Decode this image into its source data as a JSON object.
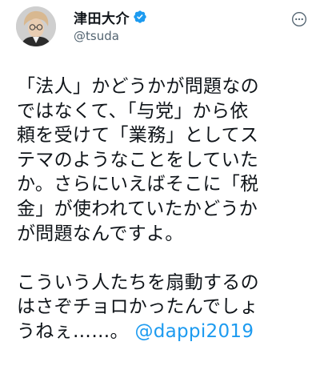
{
  "user": {
    "display_name": "津田大介",
    "handle": "@tsuda",
    "verified": true
  },
  "tweet": {
    "lines": [
      "「法人」かどうかが問題なの",
      "ではなくて、「与党」から依",
      "頼を受けて「業務」としてス",
      "テマのようなことをしていた",
      "か。さらにいえばそこに「税",
      "金」が使われていたかどうか",
      "が問題なんですよ。"
    ],
    "lines2": [
      "こういう人たちを扇動するの",
      "はさぞチョロかったんでしょ"
    ],
    "last_line_text": "うねぇ……。",
    "mention": "@dappi2019"
  },
  "colors": {
    "accent": "#1d9bf0",
    "text": "#0f1419",
    "secondary": "#536471"
  },
  "icons": {
    "verified": "verified-badge-icon",
    "more": "more-options-icon"
  }
}
